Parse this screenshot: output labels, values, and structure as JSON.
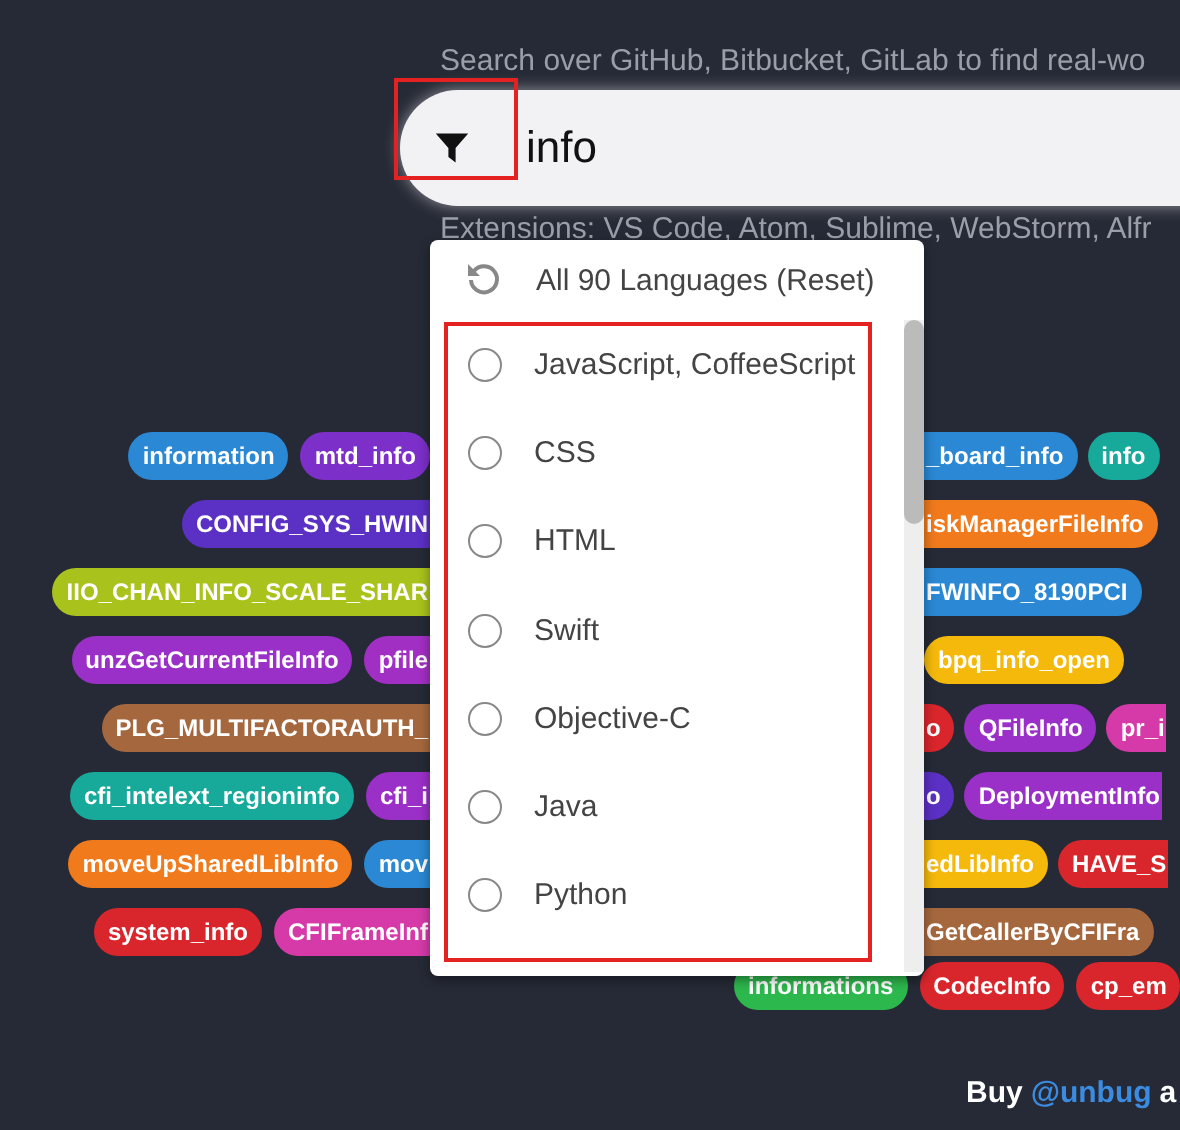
{
  "search": {
    "hint": "Search over GitHub, Bitbucket, GitLab to find real-wo",
    "value": "info",
    "extensions": "Extensions: VS Code, Atom, Sublime, WebStorm, Alfr"
  },
  "dropdown": {
    "reset": "All 90 Languages (Reset)",
    "options": [
      {
        "label": "JavaScript, CoffeeScript",
        "selected": false
      },
      {
        "label": "CSS",
        "selected": false
      },
      {
        "label": "HTML",
        "selected": false
      },
      {
        "label": "Swift",
        "selected": false
      },
      {
        "label": "Objective-C",
        "selected": false
      },
      {
        "label": "Java",
        "selected": false
      },
      {
        "label": "Python",
        "selected": false
      }
    ]
  },
  "tag_rows": [
    {
      "left": [
        {
          "text": "information",
          "color": "#2a88d4",
          "clipped": false
        },
        {
          "text": "mtd_info",
          "color": "#7d2fc9",
          "clipped": false
        }
      ],
      "right": [
        {
          "text": "_board_info",
          "color": "#2a88d4",
          "clipped": true
        },
        {
          "text": "info",
          "color": "#17a99a",
          "clipped": false
        }
      ]
    },
    {
      "left": [
        {
          "text": "CONFIG_SYS_HWIN",
          "color": "#5b30c4",
          "clipped": true
        }
      ],
      "right": [
        {
          "text": "iskManagerFileInfo",
          "color": "#f07a1c",
          "clipped": true
        }
      ]
    },
    {
      "left": [
        {
          "text": "IIO_CHAN_INFO_SCALE_SHAR",
          "color": "#a9c21c",
          "clipped": true
        }
      ],
      "right": [
        {
          "text": "FWINFO_8190PCI",
          "color": "#2a88d4",
          "clipped": true
        }
      ]
    },
    {
      "left": [
        {
          "text": "unzGetCurrentFileInfo",
          "color": "#9a30c8",
          "clipped": false
        },
        {
          "text": "pfile",
          "color": "#a22fc4",
          "clipped": true
        }
      ],
      "right": [
        {
          "text": "bpq_info_open",
          "color": "#f5b90c",
          "clipped": false
        }
      ]
    },
    {
      "left": [
        {
          "text": "PLG_MULTIFACTORAUTH_",
          "color": "#a5683e",
          "clipped": true
        }
      ],
      "right": [
        {
          "text": "o",
          "color": "#d9262c",
          "clipped": true
        },
        {
          "text": "QFileInfo",
          "color": "#9a30c8",
          "clipped": false
        },
        {
          "text": "pr_i",
          "color": "#d63aa8",
          "clipped": true
        }
      ]
    },
    {
      "left": [
        {
          "text": "cfi_intelext_regioninfo",
          "color": "#17a99a",
          "clipped": false
        },
        {
          "text": "cfi_i",
          "color": "#9a30c8",
          "clipped": true
        }
      ],
      "right": [
        {
          "text": "o",
          "color": "#5b30c4",
          "clipped": true
        },
        {
          "text": "DeploymentInfo",
          "color": "#9a30c8",
          "clipped": true
        }
      ]
    },
    {
      "left": [
        {
          "text": "moveUpSharedLibInfo",
          "color": "#f07a1c",
          "clipped": false
        },
        {
          "text": "mov",
          "color": "#2a88d4",
          "clipped": true
        }
      ],
      "right": [
        {
          "text": "edLibInfo",
          "color": "#f5b90c",
          "clipped": true
        },
        {
          "text": "HAVE_S",
          "color": "#d9262c",
          "clipped": true
        }
      ]
    },
    {
      "left": [
        {
          "text": "system_info",
          "color": "#d9262c",
          "clipped": false
        },
        {
          "text": "CFIFrameInf",
          "color": "#d63aa8",
          "clipped": true
        }
      ],
      "right": [
        {
          "text": "GetCallerByCFIFra",
          "color": "#a5683e",
          "clipped": true
        }
      ]
    }
  ],
  "bottom_tags": [
    {
      "text": "informations",
      "color": "#2db84d"
    },
    {
      "text": "CodecInfo",
      "color": "#d9262c"
    },
    {
      "text": "cp_em",
      "color": "#d9262c"
    }
  ],
  "footer": {
    "buy": "Buy",
    "handle": "@unbug",
    "rest": "a"
  }
}
